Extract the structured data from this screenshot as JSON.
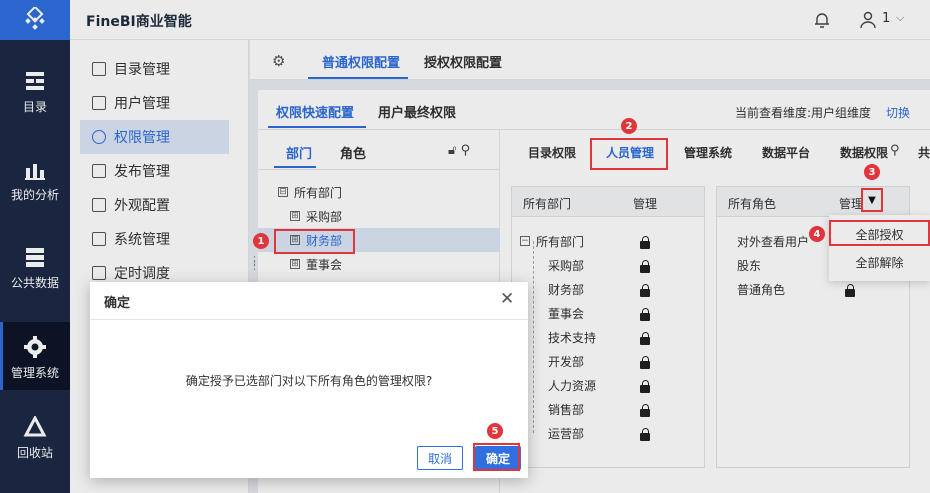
{
  "app": {
    "title": "FineBI商业智能"
  },
  "topbar": {
    "user": "1"
  },
  "nav": [
    {
      "label": "目录",
      "icon": "catalog-icon"
    },
    {
      "label": "我的分析",
      "icon": "chart-icon"
    },
    {
      "label": "公共数据",
      "icon": "database-icon"
    },
    {
      "label": "管理系统",
      "icon": "gear-icon",
      "active": true
    },
    {
      "label": "回收站",
      "icon": "recycle-icon"
    }
  ],
  "submenu": [
    {
      "label": "目录管理"
    },
    {
      "label": "用户管理"
    },
    {
      "label": "权限管理",
      "active": true
    },
    {
      "label": "发布管理"
    },
    {
      "label": "外观配置"
    },
    {
      "label": "系统管理"
    },
    {
      "label": "定时调度"
    }
  ],
  "main_tabs": [
    {
      "label": "普通权限配置",
      "active": true
    },
    {
      "label": "授权权限配置"
    }
  ],
  "panel_tabs": [
    {
      "label": "权限快速配置",
      "active": true
    },
    {
      "label": "用户最终权限"
    }
  ],
  "dimension": {
    "label": "当前查看维度:用户组维度",
    "switch": "切换"
  },
  "left_tabs": [
    {
      "label": "部门",
      "active": true
    },
    {
      "label": "角色"
    }
  ],
  "dept_tree": [
    {
      "label": "所有部门",
      "toggle": "⊟",
      "indent": 0
    },
    {
      "label": "采购部",
      "toggle": "⊞",
      "indent": 1
    },
    {
      "label": "财务部",
      "toggle": "⊞",
      "indent": 1,
      "selected": true
    },
    {
      "label": "董事会",
      "toggle": "⊞",
      "indent": 1
    }
  ],
  "right_tabs": [
    {
      "label": "目录权限"
    },
    {
      "label": "人员管理",
      "active": true
    },
    {
      "label": "管理系统"
    },
    {
      "label": "数据平台"
    },
    {
      "label": "数据权限"
    },
    {
      "label": "共"
    }
  ],
  "box1": {
    "col1": "所有部门",
    "col2": "管理",
    "rows": [
      "所有部门",
      "采购部",
      "财务部",
      "董事会",
      "技术支持",
      "开发部",
      "人力资源",
      "销售部",
      "运营部"
    ]
  },
  "box2": {
    "col1": "所有角色",
    "col2": "管理",
    "rows": [
      "对外查看用户",
      "股东",
      "普通角色"
    ]
  },
  "dropdown": {
    "items": [
      "全部授权",
      "全部解除"
    ]
  },
  "dialog": {
    "title": "确定",
    "message": "确定授予已选部门对以下所有角色的管理权限?",
    "cancel": "取消",
    "ok": "确定"
  },
  "annotations": [
    "1",
    "2",
    "3",
    "4",
    "5"
  ],
  "colors": {
    "accent": "#2f6fe0",
    "nav_bg": "#1d2a45",
    "highlight": "#e0353b"
  }
}
